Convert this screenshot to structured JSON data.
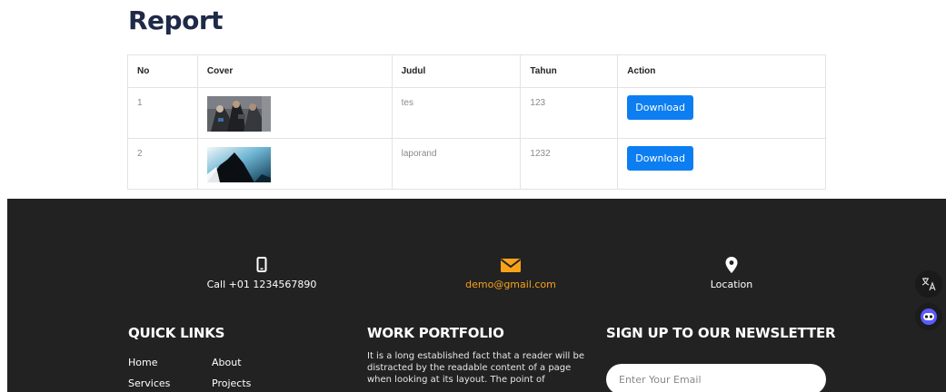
{
  "page": {
    "title": "Report"
  },
  "table": {
    "headers": [
      "No",
      "Cover",
      "Judul",
      "Tahun",
      "Action"
    ],
    "rows": [
      {
        "no": "1",
        "judul": "tes",
        "tahun": "123",
        "action": "Download"
      },
      {
        "no": "2",
        "judul": "laporand",
        "tahun": "1232",
        "action": "Download"
      }
    ]
  },
  "footer": {
    "phone": {
      "icon": "phone-icon",
      "text": "Call +01 1234567890"
    },
    "email": {
      "icon": "envelope-icon",
      "text": "demo@gmail.com"
    },
    "location": {
      "icon": "map-pin-icon",
      "text": "Location"
    },
    "quick_links": {
      "title": "QUICK LINKS",
      "items": [
        "Home",
        "About",
        "Services",
        "Projects"
      ]
    },
    "work_portfolio": {
      "title": "WORK PORTFOLIO",
      "text": "It is a long established fact that a reader will be distracted by the readable content of a page when looking at its layout. The point of"
    },
    "newsletter": {
      "title": "SIGN UP TO OUR NEWSLETTER",
      "placeholder": "Enter Your Email"
    }
  },
  "colors": {
    "title": "#1f2a48",
    "button": "#0d7ef2",
    "footer_bg": "#222222",
    "email_accent": "#f7a21b"
  }
}
